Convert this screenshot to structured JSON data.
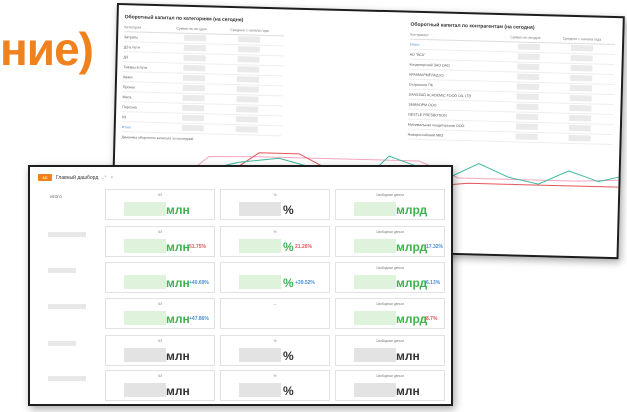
{
  "heading": "ние)",
  "back_window": {
    "left_title": "Оборотный капитал по категориям (на сегодня)",
    "left_columns": [
      "Категория",
      "Сумма на сегодня",
      "Среднее с начала года"
    ],
    "left_rows": [
      "Затраты",
      "ДЗ в пути",
      "ДЗ",
      "Товары в пути",
      "Аванс",
      "Прочее",
      "Маса",
      "Персона",
      "КЗ",
      "Итого"
    ],
    "right_title": "Оборотный капитал по контрагентам (на сегодня)",
    "right_columns": [
      "Контрагент",
      "Сумма на сегодня",
      "Среднее с начала года"
    ],
    "right_rows": [
      "Итого",
      "АО \"ВСК\"",
      "Кондитерский ЗАО ОАО",
      "КРАКМАРМЕЛАД КЗ",
      "Острополи ПК",
      "SANSSAD ACADEMIC FOOD OIL LTD",
      "ЗМИФОРМ ООО",
      "NESTLE PRESBOTION",
      "Минимальная кондитерская ООО",
      "Новороссийский МКЗ"
    ],
    "chart_title": "Динамика оборотного капитала за последний",
    "colors": {
      "line_red": "#e5555a",
      "line_teal": "#3cb8a0",
      "line_pink": "#f3a7c0"
    }
  },
  "front_window": {
    "title": "Главный дашборд",
    "logo": "1С",
    "header_icons": [
      "link-icon",
      "close-icon"
    ],
    "first_row_label": "ИТОГО",
    "columns_caption": [
      "ЧЗ",
      "%",
      "Свободные деньги"
    ],
    "rows": [
      {
        "cells": [
          {
            "caption": "ЧЗ",
            "unit": "млн",
            "style": "green",
            "delta": "",
            "delta_color": ""
          },
          {
            "caption": "%",
            "unit": "%",
            "style": "gray",
            "delta": "",
            "delta_color": ""
          },
          {
            "caption": "Свободные деньги",
            "unit": "млрд",
            "style": "green",
            "delta": "",
            "delta_color": ""
          }
        ]
      },
      {
        "cells": [
          {
            "caption": "ЧЗ",
            "unit": "млн",
            "style": "green",
            "delta": "51.75%",
            "delta_color": "red"
          },
          {
            "caption": "%",
            "unit": "%",
            "style": "green",
            "delta": "21.26%",
            "delta_color": "red"
          },
          {
            "caption": "Свободные деньги",
            "unit": "млрд",
            "style": "green",
            "delta": "17.32%",
            "delta_color": "blue"
          }
        ]
      },
      {
        "cells": [
          {
            "caption": "",
            "unit": "млн",
            "style": "green",
            "delta": "+40.69%",
            "delta_color": "blue"
          },
          {
            "caption": "",
            "unit": "%",
            "style": "green",
            "delta": "+39.52%",
            "delta_color": "blue"
          },
          {
            "caption": "Свободные деньги",
            "unit": "млрд",
            "style": "green",
            "delta": "6.13%",
            "delta_color": "blue"
          }
        ]
      },
      {
        "cells": [
          {
            "caption": "ЧЗ",
            "unit": "млн",
            "style": "green",
            "delta": "+47.86%",
            "delta_color": "blue"
          },
          {
            "caption": "—",
            "unit": "",
            "style": "empty",
            "delta": "",
            "delta_color": ""
          },
          {
            "caption": "Свободные деньги",
            "unit": "млрд",
            "style": "green",
            "delta": "8.7%",
            "delta_color": "red"
          }
        ]
      },
      {
        "cells": [
          {
            "caption": "ЧЗ",
            "unit": "млн",
            "style": "gray",
            "delta": "",
            "delta_color": ""
          },
          {
            "caption": "%",
            "unit": "%",
            "style": "gray",
            "delta": "",
            "delta_color": ""
          },
          {
            "caption": "Свободные деньги",
            "unit": "млн",
            "style": "gray",
            "delta": "",
            "delta_color": ""
          }
        ]
      },
      {
        "cells": [
          {
            "caption": "ЧЗ",
            "unit": "млн",
            "style": "gray",
            "delta": "",
            "delta_color": ""
          },
          {
            "caption": "%",
            "unit": "%",
            "style": "gray",
            "delta": "",
            "delta_color": ""
          },
          {
            "caption": "Свободные деньги",
            "unit": "млн",
            "style": "gray",
            "delta": "",
            "delta_color": ""
          }
        ]
      }
    ]
  }
}
